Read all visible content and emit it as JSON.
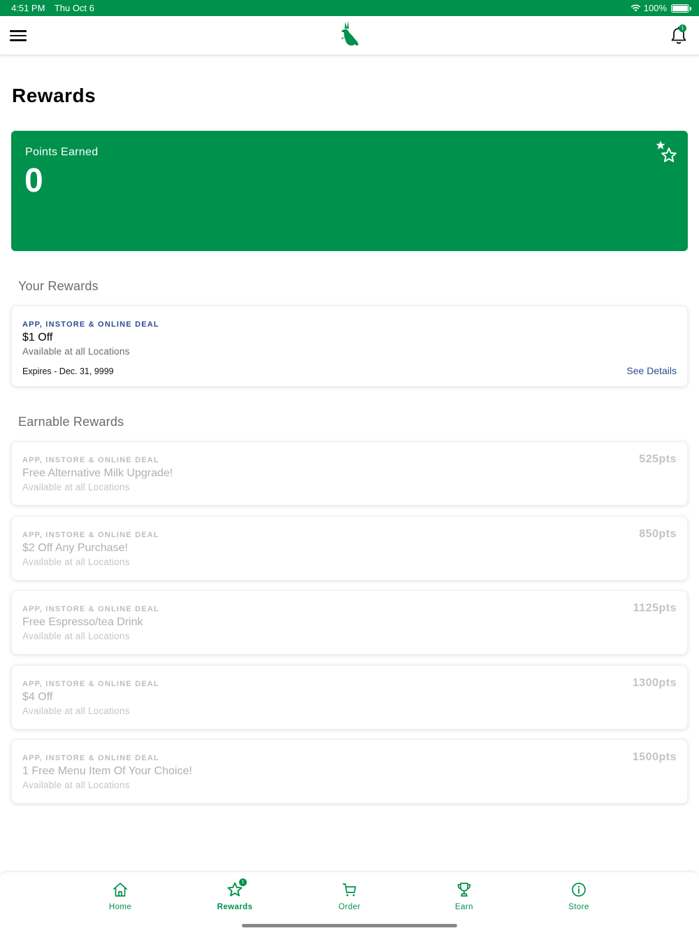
{
  "status_bar": {
    "time": "4:51 PM",
    "date": "Thu Oct 6",
    "battery": "100%"
  },
  "header": {
    "notification_count": "1",
    "accent_color": "#00914c"
  },
  "page": {
    "title": "Rewards"
  },
  "points_card": {
    "label": "Points Earned",
    "value": "0"
  },
  "your_rewards": {
    "title": "Your Rewards",
    "items": [
      {
        "tag": "APP, INSTORE & ONLINE DEAL",
        "title": "$1 Off",
        "subtitle": "Available at all Locations",
        "expires": "Expires - Dec. 31, 9999",
        "link": "See Details"
      }
    ]
  },
  "earnable_rewards": {
    "title": "Earnable Rewards",
    "items": [
      {
        "tag": "APP, INSTORE & ONLINE DEAL",
        "title": "Free Alternative Milk Upgrade!",
        "subtitle": "Available at all Locations",
        "points": "525pts"
      },
      {
        "tag": "APP, INSTORE & ONLINE DEAL",
        "title": "$2 Off Any Purchase!",
        "subtitle": "Available at all Locations",
        "points": "850pts"
      },
      {
        "tag": "APP, INSTORE & ONLINE DEAL",
        "title": "Free Espresso/tea Drink",
        "subtitle": "Available at all Locations",
        "points": "1125pts"
      },
      {
        "tag": "APP, INSTORE & ONLINE DEAL",
        "title": "$4 Off",
        "subtitle": "Available at all Locations",
        "points": "1300pts"
      },
      {
        "tag": "APP, INSTORE & ONLINE DEAL",
        "title": "1 Free Menu Item Of Your Choice!",
        "subtitle": "Available at all Locations",
        "points": "1500pts"
      }
    ]
  },
  "tabs": [
    {
      "label": "Home",
      "icon": "home-icon"
    },
    {
      "label": "Rewards",
      "icon": "star-icon",
      "badge": "1"
    },
    {
      "label": "Order",
      "icon": "cart-icon"
    },
    {
      "label": "Earn",
      "icon": "trophy-icon"
    },
    {
      "label": "Store",
      "icon": "info-icon"
    }
  ]
}
